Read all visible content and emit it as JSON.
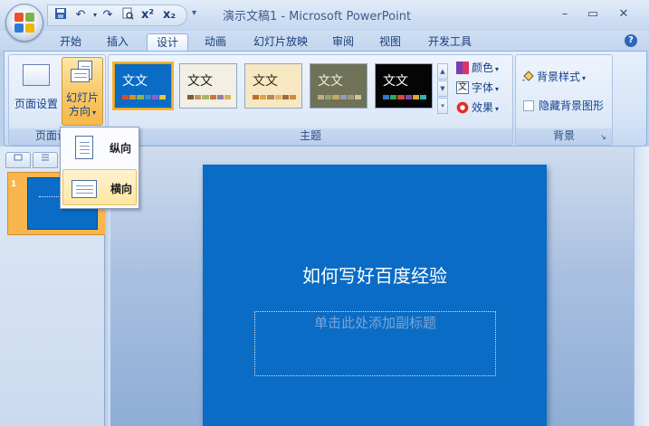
{
  "window": {
    "title": "演示文稿1 - Microsoft PowerPoint",
    "minimize": "–",
    "maximize": "▭",
    "close": "✕"
  },
  "quick_access": {
    "save_icon": "save-icon",
    "undo_icon": "undo-icon",
    "redo_icon": "redo-icon",
    "print_preview_icon": "print-preview-icon",
    "superscript": "x²",
    "subscript": "x₂",
    "customize": "▾"
  },
  "tabs": [
    "开始",
    "插入",
    "设计",
    "动画",
    "幻灯片放映",
    "审阅",
    "视图",
    "开发工具"
  ],
  "active_tab": "设计",
  "ribbon": {
    "page_setup": {
      "page_setup_label": "页面设置",
      "orientation_label_line1": "幻灯片",
      "orientation_label_line2": "方向",
      "group_label": "页面设置"
    },
    "themes": {
      "group_label": "主题",
      "items": [
        {
          "text": "文文",
          "bg": "#0a6cc4",
          "fg": "#ffffff"
        },
        {
          "text": "文文",
          "bg": "#f3efe4",
          "fg": "#1b1b1b"
        },
        {
          "text": "文文",
          "bg": "#f7e7c2",
          "fg": "#3a2a10"
        },
        {
          "text": "文文",
          "bg": "#6f7256",
          "fg": "#f0f0e0"
        },
        {
          "text": "文文",
          "bg": "#050505",
          "fg": "#ffffff"
        }
      ],
      "colors": "颜色",
      "fonts": "字体",
      "effects": "效果"
    },
    "background": {
      "group_label": "背景",
      "styles": "背景样式",
      "hide_graphics": "隐藏背景图形"
    }
  },
  "orientation_menu": {
    "portrait": "纵向",
    "landscape": "横向"
  },
  "slide": {
    "number": "1",
    "title": "如何写好百度经验",
    "subtitle_placeholder": "单击此处添加副标题"
  }
}
